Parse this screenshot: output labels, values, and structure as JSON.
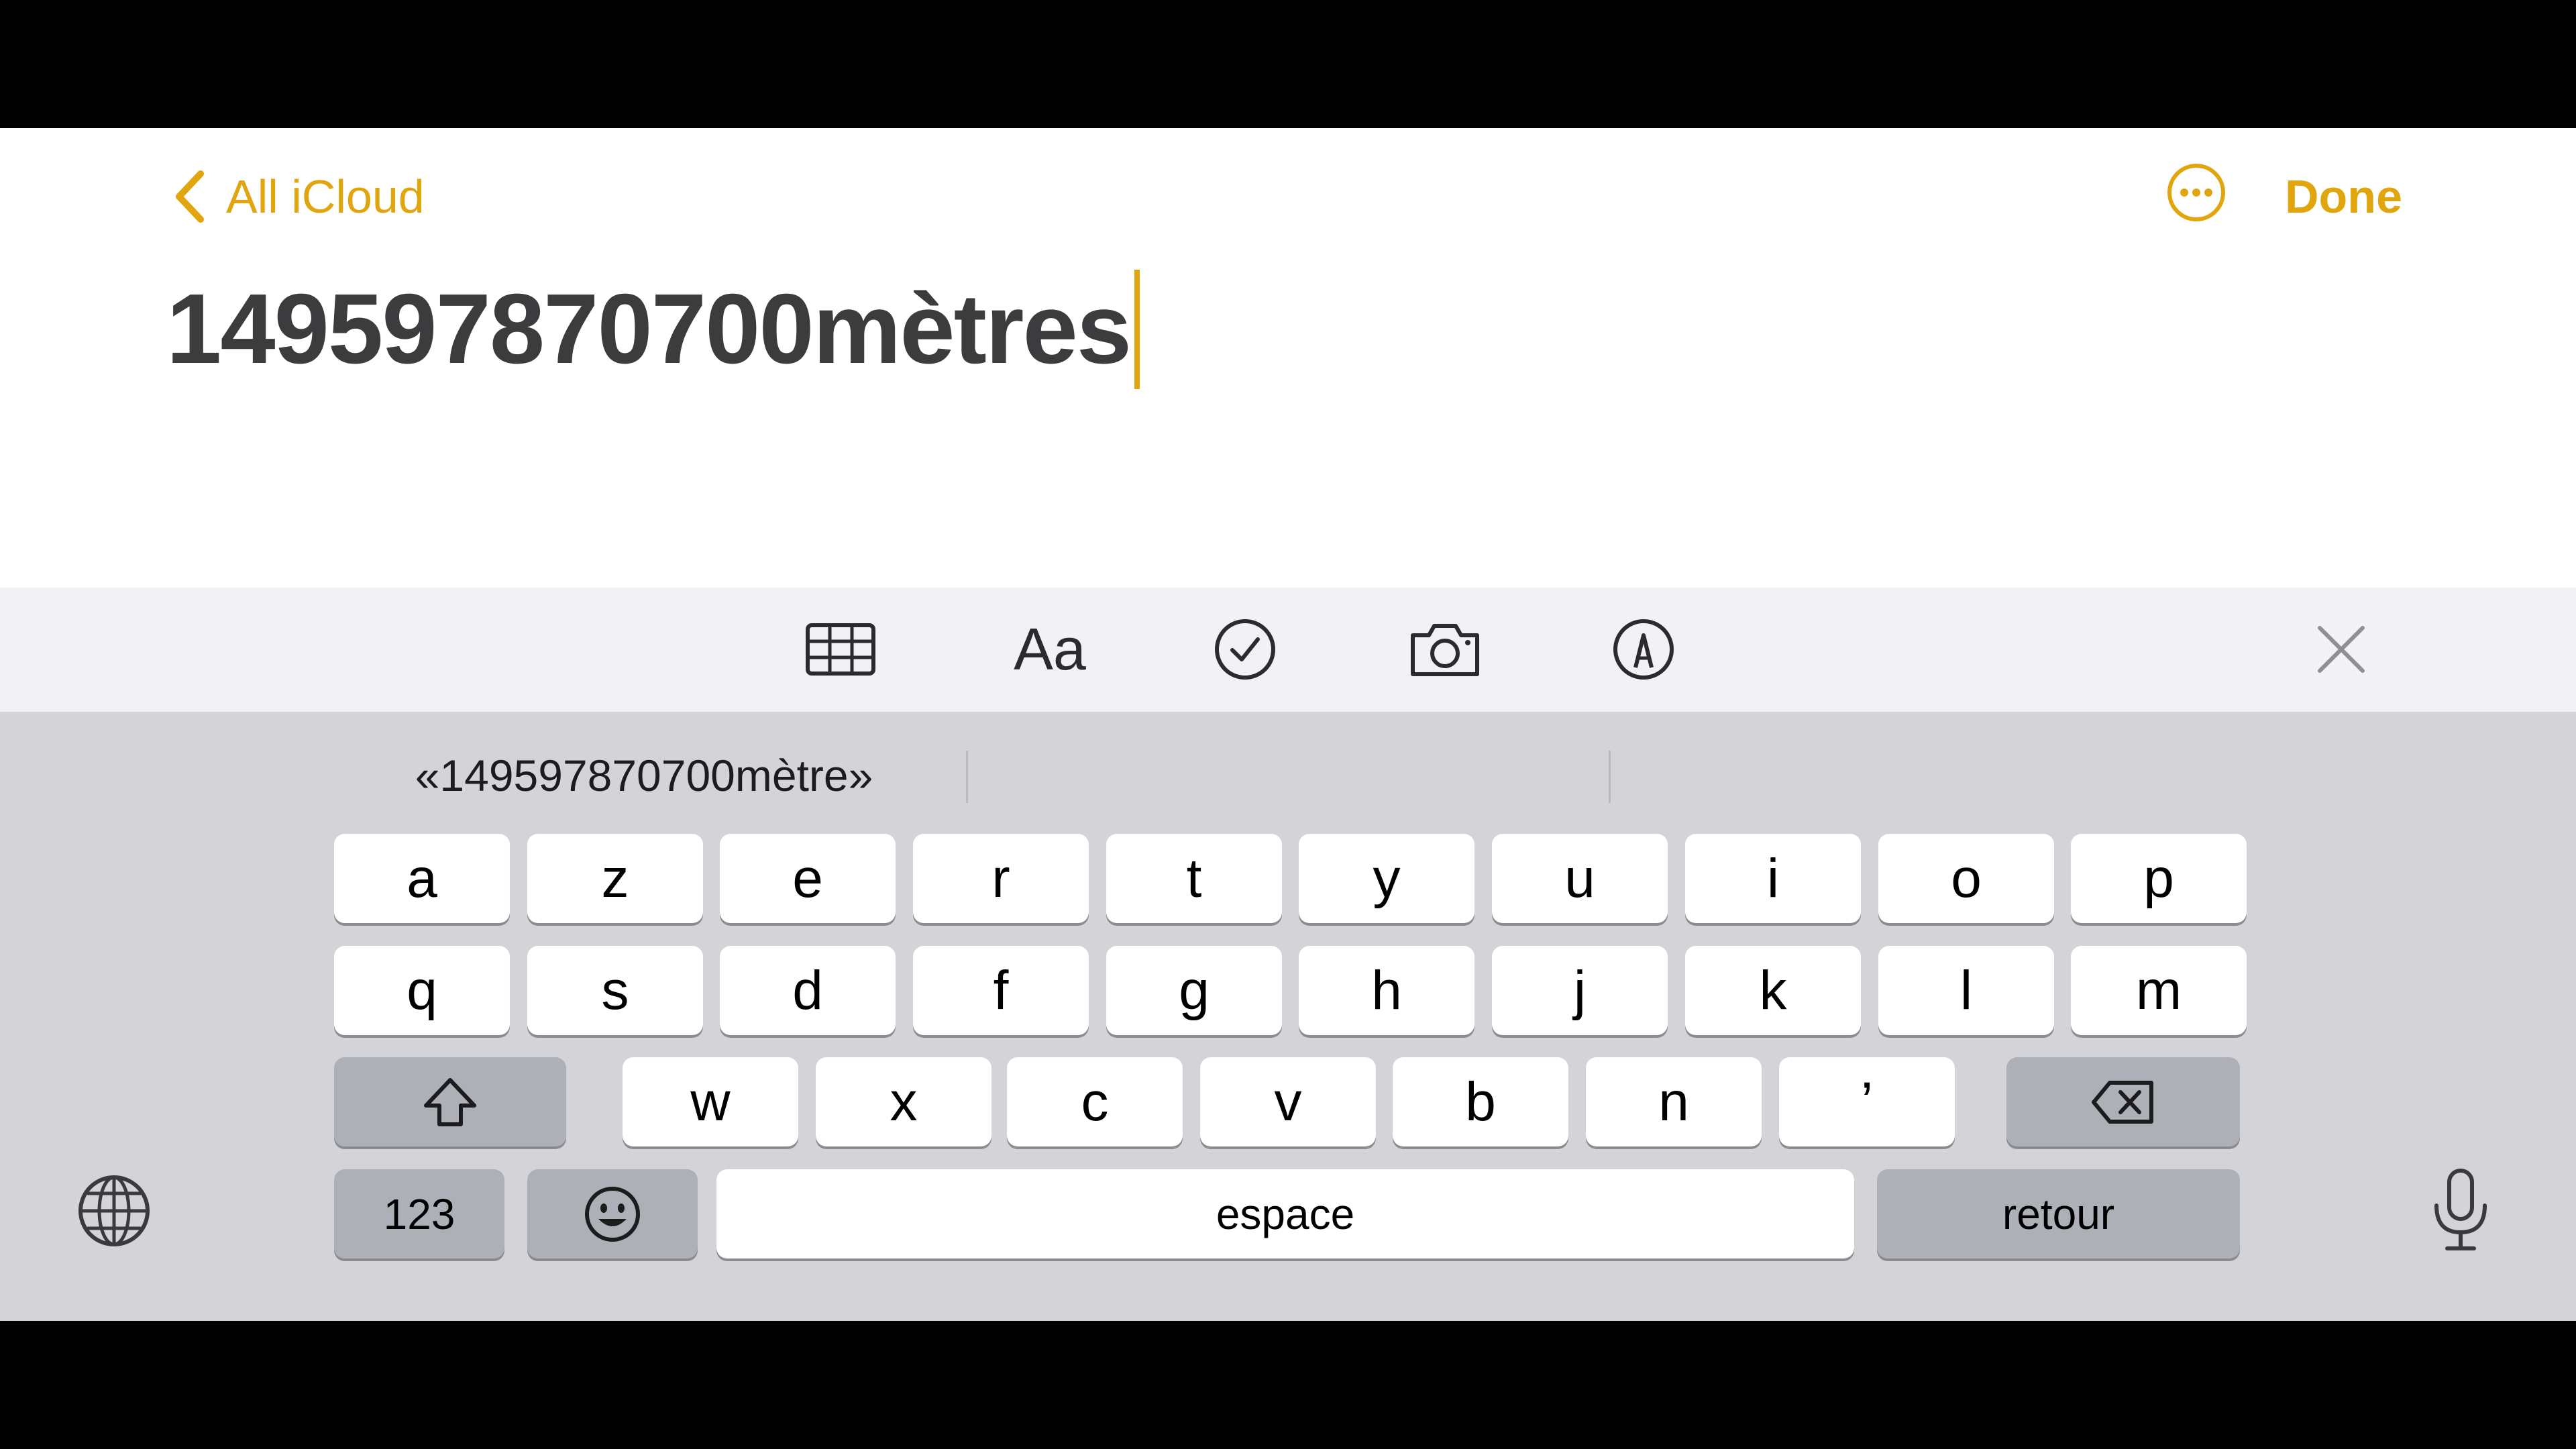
{
  "nav": {
    "back_label": "All iCloud",
    "done_label": "Done"
  },
  "note": {
    "title": "149597870700mètres"
  },
  "toolbar": {
    "aa_label": "Aa"
  },
  "keyboard": {
    "suggestions": [
      "«149597870700mètre»",
      "",
      ""
    ],
    "row1": [
      "a",
      "z",
      "e",
      "r",
      "t",
      "y",
      "u",
      "i",
      "o",
      "p"
    ],
    "row2": [
      "q",
      "s",
      "d",
      "f",
      "g",
      "h",
      "j",
      "k",
      "l",
      "m"
    ],
    "row3": [
      "w",
      "x",
      "c",
      "v",
      "b",
      "n",
      "’"
    ],
    "numbers_label": "123",
    "space_label": "espace",
    "return_label": "retour"
  },
  "colors": {
    "accent": "#e1a50d",
    "keyboard_bg": "#d3d3d8",
    "toolbar_bg": "#f2f2f6"
  },
  "icons": [
    "chevron-left-icon",
    "more-icon",
    "table-icon",
    "checklist-icon",
    "camera-icon",
    "markup-icon",
    "close-icon",
    "shift-icon",
    "delete-icon",
    "emoji-icon",
    "globe-icon",
    "microphone-icon"
  ]
}
